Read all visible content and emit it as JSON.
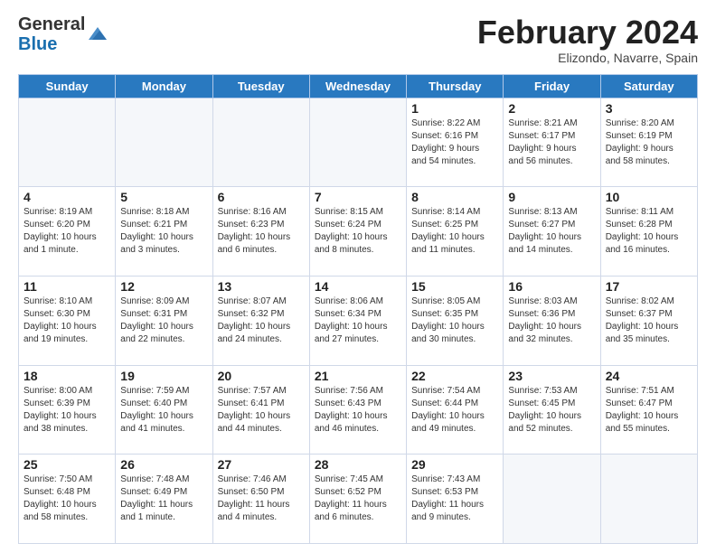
{
  "header": {
    "logo_general": "General",
    "logo_blue": "Blue",
    "month_title": "February 2024",
    "subtitle": "Elizondo, Navarre, Spain"
  },
  "days_of_week": [
    "Sunday",
    "Monday",
    "Tuesday",
    "Wednesday",
    "Thursday",
    "Friday",
    "Saturday"
  ],
  "weeks": [
    [
      {
        "day": "",
        "info": ""
      },
      {
        "day": "",
        "info": ""
      },
      {
        "day": "",
        "info": ""
      },
      {
        "day": "",
        "info": ""
      },
      {
        "day": "1",
        "info": "Sunrise: 8:22 AM\nSunset: 6:16 PM\nDaylight: 9 hours\nand 54 minutes."
      },
      {
        "day": "2",
        "info": "Sunrise: 8:21 AM\nSunset: 6:17 PM\nDaylight: 9 hours\nand 56 minutes."
      },
      {
        "day": "3",
        "info": "Sunrise: 8:20 AM\nSunset: 6:19 PM\nDaylight: 9 hours\nand 58 minutes."
      }
    ],
    [
      {
        "day": "4",
        "info": "Sunrise: 8:19 AM\nSunset: 6:20 PM\nDaylight: 10 hours\nand 1 minute."
      },
      {
        "day": "5",
        "info": "Sunrise: 8:18 AM\nSunset: 6:21 PM\nDaylight: 10 hours\nand 3 minutes."
      },
      {
        "day": "6",
        "info": "Sunrise: 8:16 AM\nSunset: 6:23 PM\nDaylight: 10 hours\nand 6 minutes."
      },
      {
        "day": "7",
        "info": "Sunrise: 8:15 AM\nSunset: 6:24 PM\nDaylight: 10 hours\nand 8 minutes."
      },
      {
        "day": "8",
        "info": "Sunrise: 8:14 AM\nSunset: 6:25 PM\nDaylight: 10 hours\nand 11 minutes."
      },
      {
        "day": "9",
        "info": "Sunrise: 8:13 AM\nSunset: 6:27 PM\nDaylight: 10 hours\nand 14 minutes."
      },
      {
        "day": "10",
        "info": "Sunrise: 8:11 AM\nSunset: 6:28 PM\nDaylight: 10 hours\nand 16 minutes."
      }
    ],
    [
      {
        "day": "11",
        "info": "Sunrise: 8:10 AM\nSunset: 6:30 PM\nDaylight: 10 hours\nand 19 minutes."
      },
      {
        "day": "12",
        "info": "Sunrise: 8:09 AM\nSunset: 6:31 PM\nDaylight: 10 hours\nand 22 minutes."
      },
      {
        "day": "13",
        "info": "Sunrise: 8:07 AM\nSunset: 6:32 PM\nDaylight: 10 hours\nand 24 minutes."
      },
      {
        "day": "14",
        "info": "Sunrise: 8:06 AM\nSunset: 6:34 PM\nDaylight: 10 hours\nand 27 minutes."
      },
      {
        "day": "15",
        "info": "Sunrise: 8:05 AM\nSunset: 6:35 PM\nDaylight: 10 hours\nand 30 minutes."
      },
      {
        "day": "16",
        "info": "Sunrise: 8:03 AM\nSunset: 6:36 PM\nDaylight: 10 hours\nand 32 minutes."
      },
      {
        "day": "17",
        "info": "Sunrise: 8:02 AM\nSunset: 6:37 PM\nDaylight: 10 hours\nand 35 minutes."
      }
    ],
    [
      {
        "day": "18",
        "info": "Sunrise: 8:00 AM\nSunset: 6:39 PM\nDaylight: 10 hours\nand 38 minutes."
      },
      {
        "day": "19",
        "info": "Sunrise: 7:59 AM\nSunset: 6:40 PM\nDaylight: 10 hours\nand 41 minutes."
      },
      {
        "day": "20",
        "info": "Sunrise: 7:57 AM\nSunset: 6:41 PM\nDaylight: 10 hours\nand 44 minutes."
      },
      {
        "day": "21",
        "info": "Sunrise: 7:56 AM\nSunset: 6:43 PM\nDaylight: 10 hours\nand 46 minutes."
      },
      {
        "day": "22",
        "info": "Sunrise: 7:54 AM\nSunset: 6:44 PM\nDaylight: 10 hours\nand 49 minutes."
      },
      {
        "day": "23",
        "info": "Sunrise: 7:53 AM\nSunset: 6:45 PM\nDaylight: 10 hours\nand 52 minutes."
      },
      {
        "day": "24",
        "info": "Sunrise: 7:51 AM\nSunset: 6:47 PM\nDaylight: 10 hours\nand 55 minutes."
      }
    ],
    [
      {
        "day": "25",
        "info": "Sunrise: 7:50 AM\nSunset: 6:48 PM\nDaylight: 10 hours\nand 58 minutes."
      },
      {
        "day": "26",
        "info": "Sunrise: 7:48 AM\nSunset: 6:49 PM\nDaylight: 11 hours\nand 1 minute."
      },
      {
        "day": "27",
        "info": "Sunrise: 7:46 AM\nSunset: 6:50 PM\nDaylight: 11 hours\nand 4 minutes."
      },
      {
        "day": "28",
        "info": "Sunrise: 7:45 AM\nSunset: 6:52 PM\nDaylight: 11 hours\nand 6 minutes."
      },
      {
        "day": "29",
        "info": "Sunrise: 7:43 AM\nSunset: 6:53 PM\nDaylight: 11 hours\nand 9 minutes."
      },
      {
        "day": "",
        "info": ""
      },
      {
        "day": "",
        "info": ""
      }
    ]
  ]
}
